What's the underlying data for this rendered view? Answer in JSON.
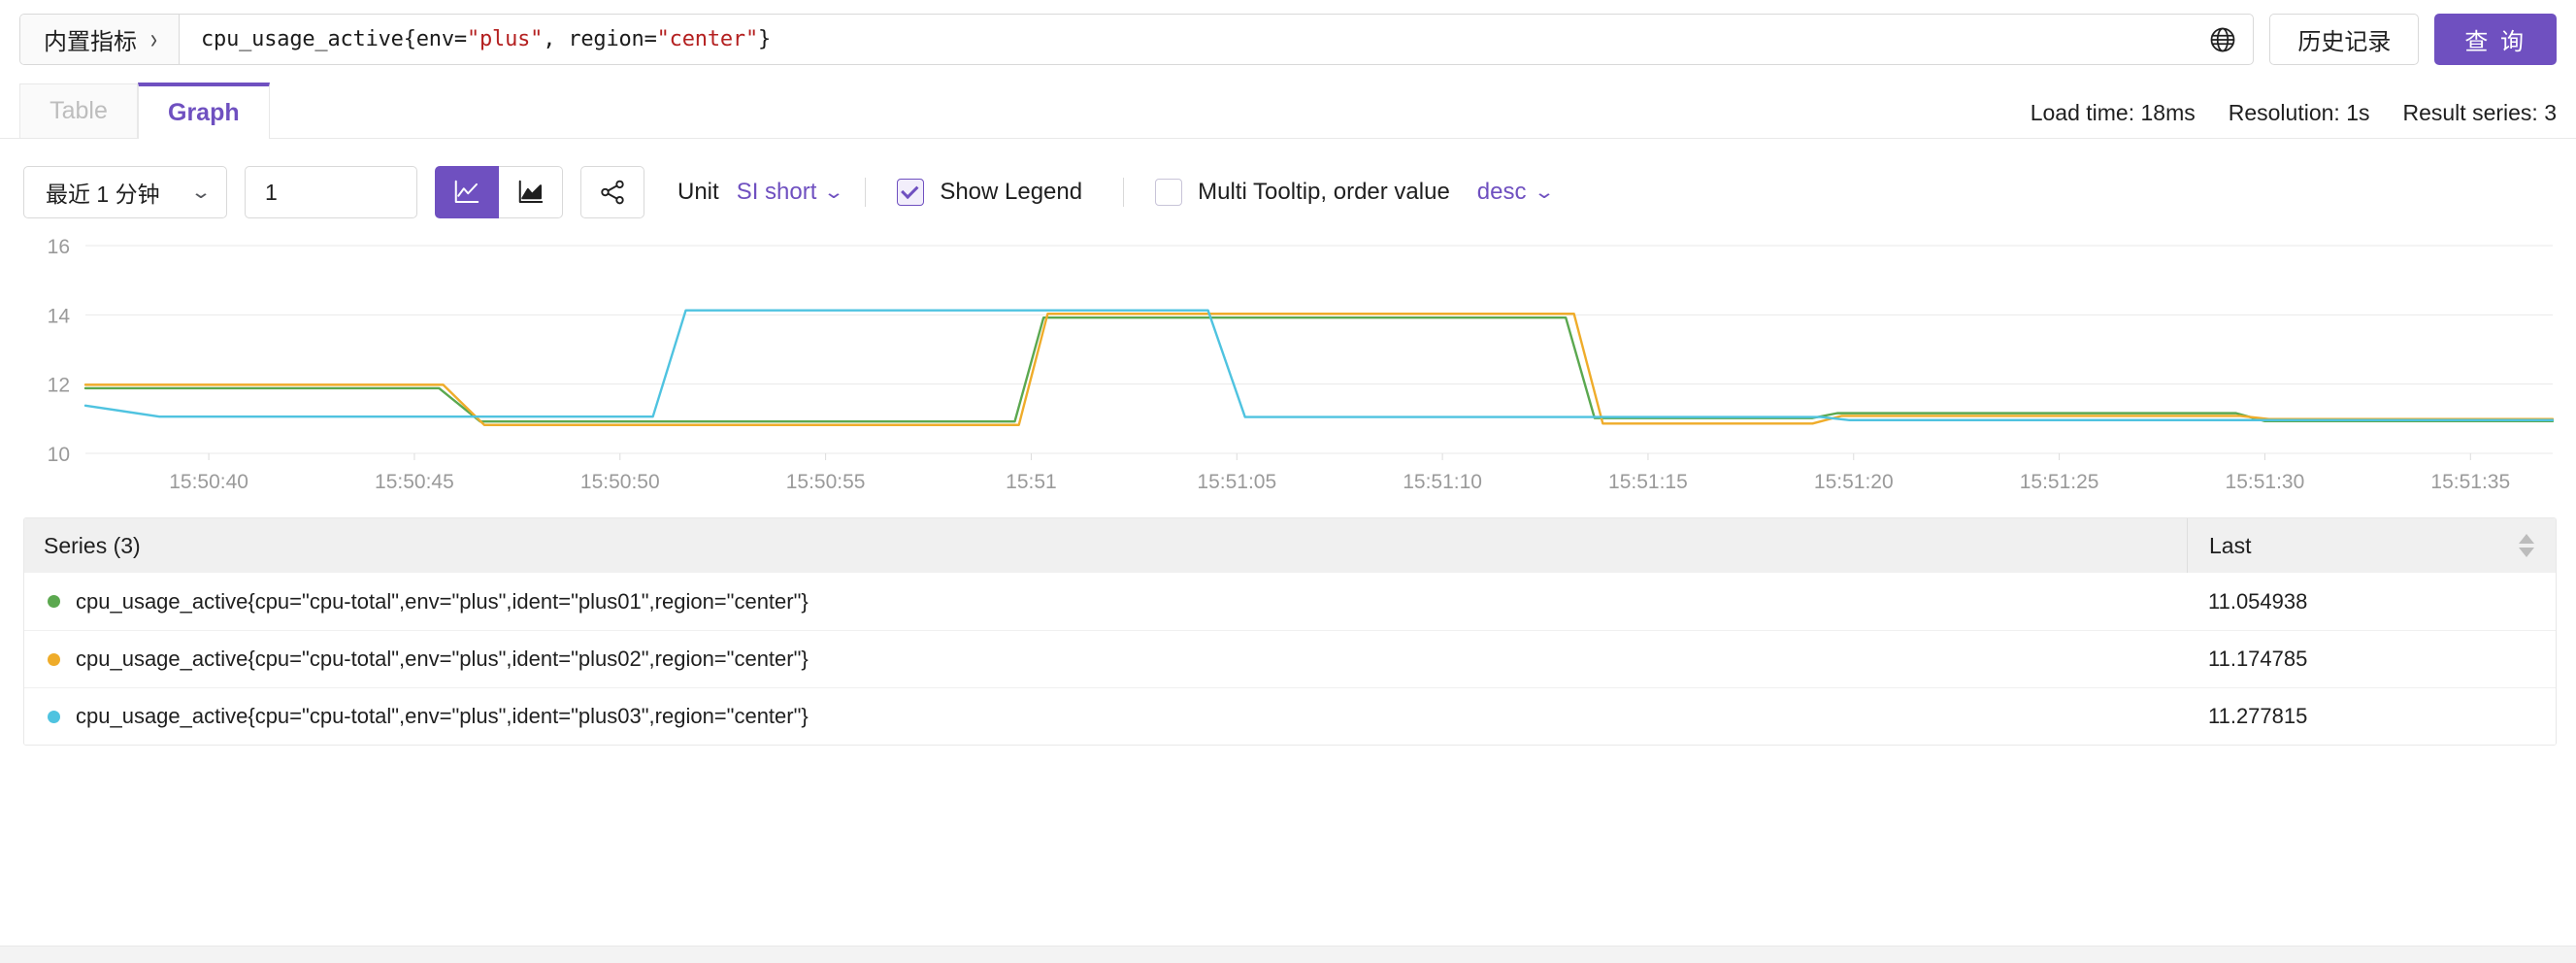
{
  "header": {
    "metric_picker_label": "内置指标",
    "metric_picker_chevron": "chevron-right-icon",
    "query_expression": "cpu_usage_active{env=\"plus\", region=\"center\"}",
    "query_expr_parts": {
      "p1": "cpu_usage_active{env=",
      "v1": "\"plus\"",
      "p2": ", region=",
      "v2": "\"center\"",
      "p3": "}"
    },
    "globe_icon": "globe-icon",
    "history_button": "历史记录",
    "query_button": "查 询",
    "accent_color": "#6f50c0",
    "value_color": "#b42020"
  },
  "tabs": [
    {
      "label": "Table",
      "active": false
    },
    {
      "label": "Graph",
      "active": true
    }
  ],
  "meta": {
    "load_time": "Load time: 18ms",
    "resolution": "Resolution: 1s",
    "result_series": "Result series: 3"
  },
  "toolbar": {
    "time_range": "最近 1 分钟",
    "step_value": "1",
    "step_placeholder": "",
    "chart_type_line": "line-chart-icon",
    "chart_type_area": "area-chart-icon",
    "share_icon": "share-icon",
    "unit_label": "Unit",
    "unit_value": "SI short",
    "show_legend_label": "Show Legend",
    "show_legend_checked": true,
    "multi_tooltip_label": "Multi Tooltip, order value",
    "multi_tooltip_checked": false,
    "order_value": "desc"
  },
  "chart_data": {
    "type": "line",
    "title": "",
    "xlabel": "",
    "ylabel": "",
    "ylim": [
      10,
      16
    ],
    "yticks": [
      10,
      12,
      14,
      16
    ],
    "grid": true,
    "legend_position": "below-table",
    "xlim": [
      "15:50:37",
      "15:51:37"
    ],
    "xticks": [
      "15:50:40",
      "15:50:45",
      "15:50:50",
      "15:50:55",
      "15:51",
      "15:51:05",
      "15:51:10",
      "15:51:15",
      "15:51:20",
      "15:51:25",
      "15:51:30",
      "15:51:35"
    ],
    "xtick_seconds": [
      40,
      45,
      50,
      55,
      60,
      65,
      70,
      75,
      80,
      85,
      90,
      95
    ],
    "series": [
      {
        "name": "cpu_usage_active{cpu=\"cpu-total\",env=\"plus\",ident=\"plus01\",region=\"center\"}",
        "color": "#5ba84f",
        "last": "11.054938",
        "points": [
          [
            37,
            11.88
          ],
          [
            45.0,
            11.88
          ],
          [
            45.6,
            11.88
          ],
          [
            46.6,
            10.92
          ],
          [
            59.6,
            10.92
          ],
          [
            60.3,
            13.92
          ],
          [
            73.0,
            13.92
          ],
          [
            73.7,
            11.02
          ],
          [
            79.0,
            11.02
          ],
          [
            79.6,
            11.16
          ],
          [
            89.3,
            11.16
          ],
          [
            90.0,
            10.93
          ],
          [
            97,
            10.93
          ]
        ]
      },
      {
        "name": "cpu_usage_active{cpu=\"cpu-total\",env=\"plus\",ident=\"plus02\",region=\"center\"}",
        "color": "#efac2a",
        "last": "11.174785",
        "points": [
          [
            37,
            11.98
          ],
          [
            45.0,
            11.98
          ],
          [
            45.7,
            11.98
          ],
          [
            46.7,
            10.82
          ],
          [
            59.7,
            10.82
          ],
          [
            60.4,
            14.03
          ],
          [
            73.2,
            14.03
          ],
          [
            73.9,
            10.86
          ],
          [
            79.0,
            10.86
          ],
          [
            79.7,
            11.08
          ],
          [
            89.4,
            11.08
          ],
          [
            90.1,
            10.99
          ],
          [
            97,
            10.99
          ]
        ]
      },
      {
        "name": "cpu_usage_active{cpu=\"cpu-total\",env=\"plus\",ident=\"plus03\",region=\"center\"}",
        "color": "#4fc3e0",
        "last": "11.277815",
        "points": [
          [
            37,
            11.38
          ],
          [
            38.8,
            11.06
          ],
          [
            50.8,
            11.06
          ],
          [
            51.6,
            14.13
          ],
          [
            64.3,
            14.13
          ],
          [
            65.2,
            11.05
          ],
          [
            79.2,
            11.05
          ],
          [
            79.9,
            10.96
          ],
          [
            89.6,
            10.96
          ],
          [
            90.2,
            10.96
          ],
          [
            97,
            10.96
          ]
        ]
      }
    ]
  },
  "legend_table": {
    "series_header": "Series (3)",
    "last_header": "Last",
    "sort_icon": "sort-arrows-icon",
    "rows": [
      {
        "color": "#5ba84f",
        "name": "cpu_usage_active{cpu=\"cpu-total\",env=\"plus\",ident=\"plus01\",region=\"center\"}",
        "last": "11.054938"
      },
      {
        "color": "#efac2a",
        "name": "cpu_usage_active{cpu=\"cpu-total\",env=\"plus\",ident=\"plus02\",region=\"center\"}",
        "last": "11.174785"
      },
      {
        "color": "#4fc3e0",
        "name": "cpu_usage_active{cpu=\"cpu-total\",env=\"plus\",ident=\"plus03\",region=\"center\"}",
        "last": "11.277815"
      }
    ]
  }
}
